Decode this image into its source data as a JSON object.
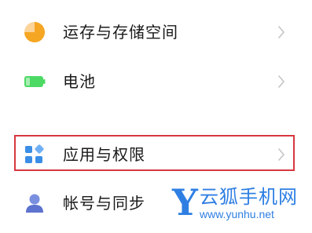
{
  "settings": {
    "items": [
      {
        "label": "运存与存储空间",
        "icon": "storage-pie-icon"
      },
      {
        "label": "电池",
        "icon": "battery-icon"
      },
      {
        "label": "应用与权限",
        "icon": "apps-grid-icon",
        "highlighted": true
      },
      {
        "label": "帐号与同步",
        "icon": "account-icon"
      }
    ]
  },
  "watermark": {
    "logo_letter": "Y",
    "title": "云狐手机网",
    "url": "www.yunhu.net"
  },
  "colors": {
    "storage_orange": "#f5a623",
    "battery_green": "#4cd964",
    "apps_blue": "#3a8ee6",
    "account_blue": "#6f84d8",
    "highlight_red": "#d7373f",
    "watermark_blue": "#2f7fe3"
  }
}
